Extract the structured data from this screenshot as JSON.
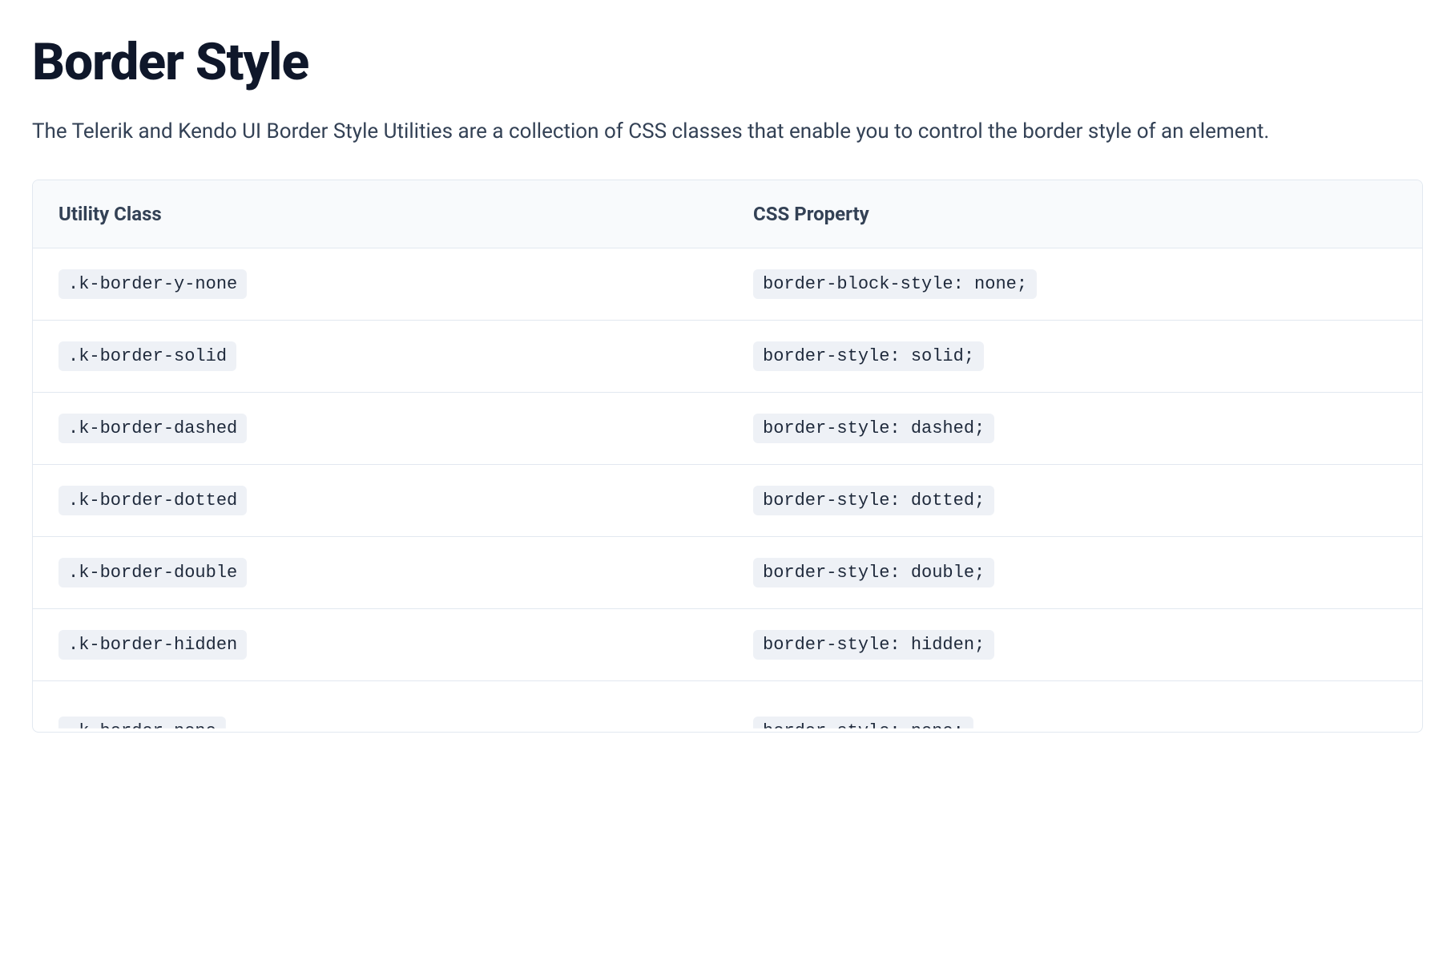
{
  "page": {
    "title": "Border Style",
    "intro": "The Telerik and Kendo UI Border Style Utilities are a collection of CSS classes that enable you to control the border style of an element."
  },
  "table": {
    "headers": {
      "utility_class": "Utility Class",
      "css_property": "CSS Property"
    },
    "rows": [
      {
        "class": ".k-border-y-none",
        "prop": "border-block-style: none;"
      },
      {
        "class": ".k-border-solid",
        "prop": "border-style: solid;"
      },
      {
        "class": ".k-border-dashed",
        "prop": "border-style: dashed;"
      },
      {
        "class": ".k-border-dotted",
        "prop": "border-style: dotted;"
      },
      {
        "class": ".k-border-double",
        "prop": "border-style: double;"
      },
      {
        "class": ".k-border-hidden",
        "prop": "border-style: hidden;"
      },
      {
        "class": ".k-border-none",
        "prop": "border-style: none;"
      }
    ]
  }
}
